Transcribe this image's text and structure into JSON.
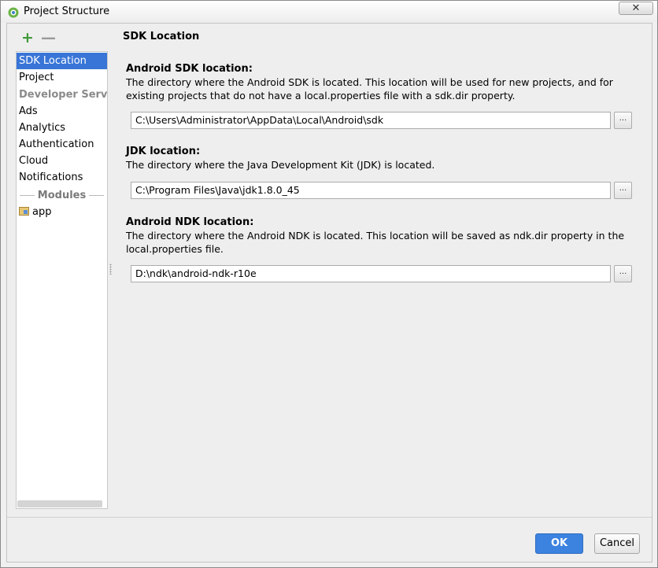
{
  "window": {
    "title": "Project Structure",
    "close_glyph": "✕",
    "app_icon": "android-studio-icon"
  },
  "toolbar": {
    "add_glyph": "+",
    "remove_glyph": "—"
  },
  "sidebar": {
    "items": [
      {
        "label": "SDK Location",
        "selected": true
      },
      {
        "label": "Project"
      },
      {
        "label": "Ads"
      },
      {
        "label": "Analytics"
      },
      {
        "label": "Authentication"
      },
      {
        "label": "Cloud"
      },
      {
        "label": "Notifications"
      }
    ],
    "developer_services_heading": "Developer Services",
    "modules_heading": "Modules",
    "modules": [
      {
        "label": "app",
        "icon": "module-folder-icon"
      }
    ]
  },
  "content": {
    "title": "SDK Location",
    "sdk": {
      "label": "Android SDK location:",
      "description": "The directory where the Android SDK is located. This location will be used for new projects, and for existing projects that do not have a local.properties file with a sdk.dir property.",
      "value": "C:\\Users\\Administrator\\AppData\\Local\\Android\\sdk",
      "browse_label": "..."
    },
    "jdk": {
      "label": "JDK location:",
      "description": "The directory where the Java Development Kit (JDK) is located.",
      "value": "C:\\Program Files\\Java\\jdk1.8.0_45",
      "browse_label": "..."
    },
    "ndk": {
      "label": "Android NDK location:",
      "description": "The directory where the Android NDK is located. This location will be saved as ndk.dir property in the local.properties file.",
      "value": "D:\\ndk\\android-ndk-r10e",
      "browse_label": "..."
    }
  },
  "footer": {
    "ok_label": "OK",
    "cancel_label": "Cancel"
  },
  "colors": {
    "selection": "#3875d7",
    "ok_button": "#3c83e0",
    "add_icon": "#3f9a39"
  }
}
